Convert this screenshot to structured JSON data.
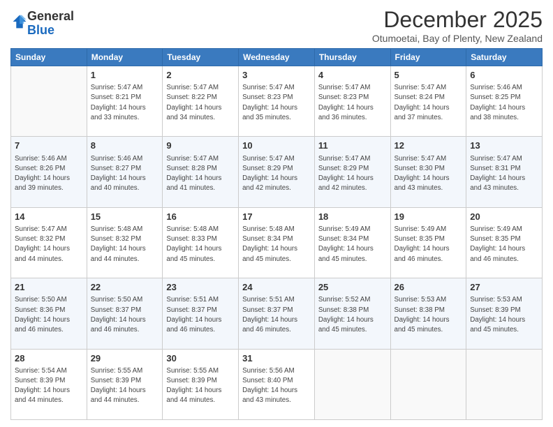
{
  "logo": {
    "general": "General",
    "blue": "Blue"
  },
  "header": {
    "month": "December 2025",
    "location": "Otumoetai, Bay of Plenty, New Zealand"
  },
  "weekdays": [
    "Sunday",
    "Monday",
    "Tuesday",
    "Wednesday",
    "Thursday",
    "Friday",
    "Saturday"
  ],
  "weeks": [
    [
      {
        "day": "",
        "info": ""
      },
      {
        "day": "1",
        "info": "Sunrise: 5:47 AM\nSunset: 8:21 PM\nDaylight: 14 hours\nand 33 minutes."
      },
      {
        "day": "2",
        "info": "Sunrise: 5:47 AM\nSunset: 8:22 PM\nDaylight: 14 hours\nand 34 minutes."
      },
      {
        "day": "3",
        "info": "Sunrise: 5:47 AM\nSunset: 8:23 PM\nDaylight: 14 hours\nand 35 minutes."
      },
      {
        "day": "4",
        "info": "Sunrise: 5:47 AM\nSunset: 8:23 PM\nDaylight: 14 hours\nand 36 minutes."
      },
      {
        "day": "5",
        "info": "Sunrise: 5:47 AM\nSunset: 8:24 PM\nDaylight: 14 hours\nand 37 minutes."
      },
      {
        "day": "6",
        "info": "Sunrise: 5:46 AM\nSunset: 8:25 PM\nDaylight: 14 hours\nand 38 minutes."
      }
    ],
    [
      {
        "day": "7",
        "info": "Sunrise: 5:46 AM\nSunset: 8:26 PM\nDaylight: 14 hours\nand 39 minutes."
      },
      {
        "day": "8",
        "info": "Sunrise: 5:46 AM\nSunset: 8:27 PM\nDaylight: 14 hours\nand 40 minutes."
      },
      {
        "day": "9",
        "info": "Sunrise: 5:47 AM\nSunset: 8:28 PM\nDaylight: 14 hours\nand 41 minutes."
      },
      {
        "day": "10",
        "info": "Sunrise: 5:47 AM\nSunset: 8:29 PM\nDaylight: 14 hours\nand 42 minutes."
      },
      {
        "day": "11",
        "info": "Sunrise: 5:47 AM\nSunset: 8:29 PM\nDaylight: 14 hours\nand 42 minutes."
      },
      {
        "day": "12",
        "info": "Sunrise: 5:47 AM\nSunset: 8:30 PM\nDaylight: 14 hours\nand 43 minutes."
      },
      {
        "day": "13",
        "info": "Sunrise: 5:47 AM\nSunset: 8:31 PM\nDaylight: 14 hours\nand 43 minutes."
      }
    ],
    [
      {
        "day": "14",
        "info": "Sunrise: 5:47 AM\nSunset: 8:32 PM\nDaylight: 14 hours\nand 44 minutes."
      },
      {
        "day": "15",
        "info": "Sunrise: 5:48 AM\nSunset: 8:32 PM\nDaylight: 14 hours\nand 44 minutes."
      },
      {
        "day": "16",
        "info": "Sunrise: 5:48 AM\nSunset: 8:33 PM\nDaylight: 14 hours\nand 45 minutes."
      },
      {
        "day": "17",
        "info": "Sunrise: 5:48 AM\nSunset: 8:34 PM\nDaylight: 14 hours\nand 45 minutes."
      },
      {
        "day": "18",
        "info": "Sunrise: 5:49 AM\nSunset: 8:34 PM\nDaylight: 14 hours\nand 45 minutes."
      },
      {
        "day": "19",
        "info": "Sunrise: 5:49 AM\nSunset: 8:35 PM\nDaylight: 14 hours\nand 46 minutes."
      },
      {
        "day": "20",
        "info": "Sunrise: 5:49 AM\nSunset: 8:35 PM\nDaylight: 14 hours\nand 46 minutes."
      }
    ],
    [
      {
        "day": "21",
        "info": "Sunrise: 5:50 AM\nSunset: 8:36 PM\nDaylight: 14 hours\nand 46 minutes."
      },
      {
        "day": "22",
        "info": "Sunrise: 5:50 AM\nSunset: 8:37 PM\nDaylight: 14 hours\nand 46 minutes."
      },
      {
        "day": "23",
        "info": "Sunrise: 5:51 AM\nSunset: 8:37 PM\nDaylight: 14 hours\nand 46 minutes."
      },
      {
        "day": "24",
        "info": "Sunrise: 5:51 AM\nSunset: 8:37 PM\nDaylight: 14 hours\nand 46 minutes."
      },
      {
        "day": "25",
        "info": "Sunrise: 5:52 AM\nSunset: 8:38 PM\nDaylight: 14 hours\nand 45 minutes."
      },
      {
        "day": "26",
        "info": "Sunrise: 5:53 AM\nSunset: 8:38 PM\nDaylight: 14 hours\nand 45 minutes."
      },
      {
        "day": "27",
        "info": "Sunrise: 5:53 AM\nSunset: 8:39 PM\nDaylight: 14 hours\nand 45 minutes."
      }
    ],
    [
      {
        "day": "28",
        "info": "Sunrise: 5:54 AM\nSunset: 8:39 PM\nDaylight: 14 hours\nand 44 minutes."
      },
      {
        "day": "29",
        "info": "Sunrise: 5:55 AM\nSunset: 8:39 PM\nDaylight: 14 hours\nand 44 minutes."
      },
      {
        "day": "30",
        "info": "Sunrise: 5:55 AM\nSunset: 8:39 PM\nDaylight: 14 hours\nand 44 minutes."
      },
      {
        "day": "31",
        "info": "Sunrise: 5:56 AM\nSunset: 8:40 PM\nDaylight: 14 hours\nand 43 minutes."
      },
      {
        "day": "",
        "info": ""
      },
      {
        "day": "",
        "info": ""
      },
      {
        "day": "",
        "info": ""
      }
    ]
  ]
}
